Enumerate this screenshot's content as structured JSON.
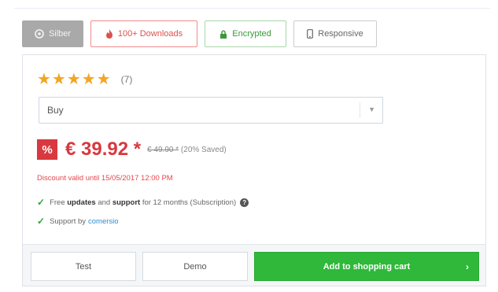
{
  "badges": {
    "silver": "Silber",
    "downloads": "100+ Downloads",
    "encrypted": "Encrypted",
    "responsive": "Responsive"
  },
  "rating": {
    "stars": "★★★★★",
    "count": "(7)"
  },
  "select": {
    "value": "Buy"
  },
  "price": {
    "percent_icon": "%",
    "current": "€ 39.92 *",
    "old": "€ 49.90 *",
    "saved": "(20% Saved)"
  },
  "discount_note": "Discount valid until 15/05/2017 12:00 PM",
  "features": {
    "line1_pre": "Free",
    "line1_updates": "updates",
    "line1_and": "and",
    "line1_support": "support",
    "line1_post": "for 12 months (Subscription)",
    "help_glyph": "?",
    "line2_pre": "Support by",
    "line2_link": "comersio"
  },
  "actions": {
    "test": "Test",
    "demo": "Demo",
    "cart": "Add to shopping cart",
    "chevron": "›"
  },
  "colors": {
    "accent_green": "#2fb83a",
    "price_red": "#d9383f",
    "star_gold": "#f2a623"
  }
}
